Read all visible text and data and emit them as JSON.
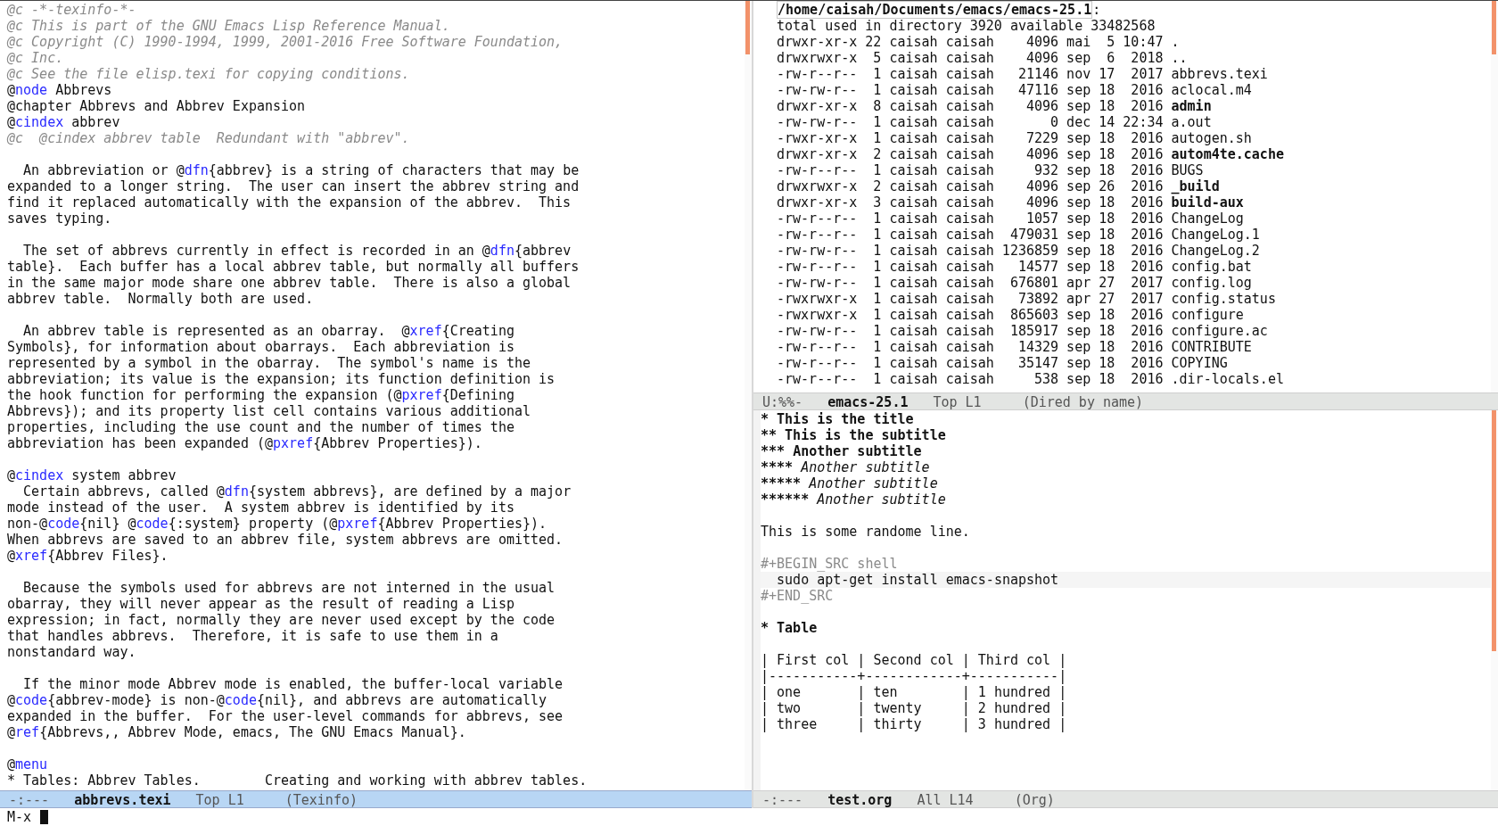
{
  "left_window": {
    "lines": [
      {
        "kind": "comment",
        "text": "@c -*-texinfo-*-"
      },
      {
        "kind": "comment",
        "text": "@c This is part of the GNU Emacs Lisp Reference Manual."
      },
      {
        "kind": "comment",
        "text": "@c Copyright (C) 1990-1994, 1999, 2001-2016 Free Software Foundation,"
      },
      {
        "kind": "comment",
        "text": "@c Inc."
      },
      {
        "kind": "comment",
        "text": "@c See the file elisp.texi for copying conditions."
      },
      {
        "kind": "text",
        "parts": [
          {
            "text": "@",
            "kind": "plain"
          },
          {
            "text": "node",
            "kind": "keyword"
          },
          {
            "text": " Abbrevs",
            "kind": "plain"
          }
        ]
      },
      {
        "kind": "text",
        "parts": [
          {
            "text": "@chapter Abbrevs and Abbrev Expansion",
            "kind": "plain"
          }
        ]
      },
      {
        "kind": "text",
        "parts": [
          {
            "text": "@",
            "kind": "plain"
          },
          {
            "text": "cindex",
            "kind": "keyword"
          },
          {
            "text": " abbrev",
            "kind": "plain"
          }
        ]
      },
      {
        "kind": "comment",
        "text": "@c  @cindex abbrev table  Redundant with \"abbrev\"."
      },
      {
        "kind": "blank"
      },
      {
        "kind": "text",
        "parts": [
          {
            "text": "  An abbreviation or @",
            "kind": "plain"
          },
          {
            "text": "dfn",
            "kind": "keyword"
          },
          {
            "text": "{abbrev} is a string of characters that may be",
            "kind": "plain"
          }
        ]
      },
      {
        "kind": "text",
        "parts": [
          {
            "text": "expanded to a longer string.  The user can insert the abbrev string and",
            "kind": "plain"
          }
        ]
      },
      {
        "kind": "text",
        "parts": [
          {
            "text": "find it replaced automatically with the expansion of the abbrev.  This",
            "kind": "plain"
          }
        ]
      },
      {
        "kind": "text",
        "parts": [
          {
            "text": "saves typing.",
            "kind": "plain"
          }
        ]
      },
      {
        "kind": "blank"
      },
      {
        "kind": "text",
        "parts": [
          {
            "text": "  The set of abbrevs currently in effect is recorded in an @",
            "kind": "plain"
          },
          {
            "text": "dfn",
            "kind": "keyword"
          },
          {
            "text": "{abbrev",
            "kind": "plain"
          }
        ]
      },
      {
        "kind": "text",
        "parts": [
          {
            "text": "table}.  Each buffer has a local abbrev table, but normally all buffers",
            "kind": "plain"
          }
        ]
      },
      {
        "kind": "text",
        "parts": [
          {
            "text": "in the same major mode share one abbrev table.  There is also a global",
            "kind": "plain"
          }
        ]
      },
      {
        "kind": "text",
        "parts": [
          {
            "text": "abbrev table.  Normally both are used.",
            "kind": "plain"
          }
        ]
      },
      {
        "kind": "blank"
      },
      {
        "kind": "text",
        "parts": [
          {
            "text": "  An abbrev table is represented as an obarray.  @",
            "kind": "plain"
          },
          {
            "text": "xref",
            "kind": "keyword"
          },
          {
            "text": "{Creating",
            "kind": "plain"
          }
        ]
      },
      {
        "kind": "text",
        "parts": [
          {
            "text": "Symbols}, for information about obarrays.  Each abbreviation is",
            "kind": "plain"
          }
        ]
      },
      {
        "kind": "text",
        "parts": [
          {
            "text": "represented by a symbol in the obarray.  The symbol's name is the",
            "kind": "plain"
          }
        ]
      },
      {
        "kind": "text",
        "parts": [
          {
            "text": "abbreviation; its value is the expansion; its function definition is",
            "kind": "plain"
          }
        ]
      },
      {
        "kind": "text",
        "parts": [
          {
            "text": "the hook function for performing the expansion (@",
            "kind": "plain"
          },
          {
            "text": "pxref",
            "kind": "keyword"
          },
          {
            "text": "{Defining",
            "kind": "plain"
          }
        ]
      },
      {
        "kind": "text",
        "parts": [
          {
            "text": "Abbrevs}); and its property list cell contains various additional",
            "kind": "plain"
          }
        ]
      },
      {
        "kind": "text",
        "parts": [
          {
            "text": "properties, including the use count and the number of times the",
            "kind": "plain"
          }
        ]
      },
      {
        "kind": "text",
        "parts": [
          {
            "text": "abbreviation has been expanded (@",
            "kind": "plain"
          },
          {
            "text": "pxref",
            "kind": "keyword"
          },
          {
            "text": "{Abbrev Properties}).",
            "kind": "plain"
          }
        ]
      },
      {
        "kind": "blank"
      },
      {
        "kind": "text",
        "parts": [
          {
            "text": "@",
            "kind": "plain"
          },
          {
            "text": "cindex",
            "kind": "keyword"
          },
          {
            "text": " system abbrev",
            "kind": "plain"
          }
        ]
      },
      {
        "kind": "text",
        "parts": [
          {
            "text": "  Certain abbrevs, called @",
            "kind": "plain"
          },
          {
            "text": "dfn",
            "kind": "keyword"
          },
          {
            "text": "{system abbrevs}, are defined by a major",
            "kind": "plain"
          }
        ]
      },
      {
        "kind": "text",
        "parts": [
          {
            "text": "mode instead of the user.  A system abbrev is identified by its",
            "kind": "plain"
          }
        ]
      },
      {
        "kind": "text",
        "parts": [
          {
            "text": "non-@",
            "kind": "plain"
          },
          {
            "text": "code",
            "kind": "keyword"
          },
          {
            "text": "{nil} @",
            "kind": "plain"
          },
          {
            "text": "code",
            "kind": "keyword"
          },
          {
            "text": "{:system} property (@",
            "kind": "plain"
          },
          {
            "text": "pxref",
            "kind": "keyword"
          },
          {
            "text": "{Abbrev Properties}).",
            "kind": "plain"
          }
        ]
      },
      {
        "kind": "text",
        "parts": [
          {
            "text": "When abbrevs are saved to an abbrev file, system abbrevs are omitted.",
            "kind": "plain"
          }
        ]
      },
      {
        "kind": "text",
        "parts": [
          {
            "text": "@",
            "kind": "plain"
          },
          {
            "text": "xref",
            "kind": "keyword"
          },
          {
            "text": "{Abbrev Files}.",
            "kind": "plain"
          }
        ]
      },
      {
        "kind": "blank"
      },
      {
        "kind": "text",
        "parts": [
          {
            "text": "  Because the symbols used for abbrevs are not interned in the usual",
            "kind": "plain"
          }
        ]
      },
      {
        "kind": "text",
        "parts": [
          {
            "text": "obarray, they will never appear as the result of reading a Lisp",
            "kind": "plain"
          }
        ]
      },
      {
        "kind": "text",
        "parts": [
          {
            "text": "expression; in fact, normally they are never used except by the code",
            "kind": "plain"
          }
        ]
      },
      {
        "kind": "text",
        "parts": [
          {
            "text": "that handles abbrevs.  Therefore, it is safe to use them in a",
            "kind": "plain"
          }
        ]
      },
      {
        "kind": "text",
        "parts": [
          {
            "text": "nonstandard way.",
            "kind": "plain"
          }
        ]
      },
      {
        "kind": "blank"
      },
      {
        "kind": "text",
        "parts": [
          {
            "text": "  If the minor mode Abbrev mode is enabled, the buffer-local variable",
            "kind": "plain"
          }
        ]
      },
      {
        "kind": "text",
        "parts": [
          {
            "text": "@",
            "kind": "plain"
          },
          {
            "text": "code",
            "kind": "keyword"
          },
          {
            "text": "{abbrev-mode} is non-@",
            "kind": "plain"
          },
          {
            "text": "code",
            "kind": "keyword"
          },
          {
            "text": "{nil}, and abbrevs are automatically",
            "kind": "plain"
          }
        ]
      },
      {
        "kind": "text",
        "parts": [
          {
            "text": "expanded in the buffer.  For the user-level commands for abbrevs, see",
            "kind": "plain"
          }
        ]
      },
      {
        "kind": "text",
        "parts": [
          {
            "text": "@",
            "kind": "plain"
          },
          {
            "text": "ref",
            "kind": "keyword"
          },
          {
            "text": "{Abbrevs,, Abbrev Mode, emacs, The GNU Emacs Manual}.",
            "kind": "plain"
          }
        ]
      },
      {
        "kind": "blank"
      },
      {
        "kind": "text",
        "parts": [
          {
            "text": "@",
            "kind": "plain"
          },
          {
            "text": "menu",
            "kind": "keyword"
          }
        ]
      },
      {
        "kind": "text",
        "parts": [
          {
            "text": "* Tables: Abbrev Tables.        Creating and working with abbrev tables.",
            "kind": "plain"
          }
        ]
      }
    ],
    "mode_line": {
      "status": "-:---",
      "buffer": "abbrevs.texi",
      "position": "Top L1",
      "mode": "(Texinfo)",
      "selected": true
    }
  },
  "dired_window": {
    "path": "/home/caisah/Documents/emacs/emacs-25.1",
    "path_suffix": ":",
    "summary": "total used in directory 3920 available 33482568",
    "entries": [
      {
        "info": "drwxr-xr-x 22 caisah caisah    4096 mai  5 10:47 ",
        "name": ".",
        "kind": "file"
      },
      {
        "info": "drwxrwxr-x  5 caisah caisah    4096 sep  6  2018 ",
        "name": "..",
        "kind": "file"
      },
      {
        "info": "-rw-r--r--  1 caisah caisah   21146 nov 17  2017 ",
        "name": "abbrevs.texi",
        "kind": "file"
      },
      {
        "info": "-rw-rw-r--  1 caisah caisah   47116 sep 18  2016 ",
        "name": "aclocal.m4",
        "kind": "file"
      },
      {
        "info": "drwxr-xr-x  8 caisah caisah    4096 sep 18  2016 ",
        "name": "admin",
        "kind": "dir"
      },
      {
        "info": "-rw-rw-r--  1 caisah caisah       0 dec 14 22:34 ",
        "name": "a.out",
        "kind": "file"
      },
      {
        "info": "-rwxr-xr-x  1 caisah caisah    7229 sep 18  2016 ",
        "name": "autogen.sh",
        "kind": "file"
      },
      {
        "info": "drwxr-xr-x  2 caisah caisah    4096 sep 18  2016 ",
        "name": "autom4te.cache",
        "kind": "dir"
      },
      {
        "info": "-rw-r--r--  1 caisah caisah     932 sep 18  2016 ",
        "name": "BUGS",
        "kind": "file"
      },
      {
        "info": "drwxrwxr-x  2 caisah caisah    4096 sep 26  2016 ",
        "name": "_build",
        "kind": "dir"
      },
      {
        "info": "drwxr-xr-x  3 caisah caisah    4096 sep 18  2016 ",
        "name": "build-aux",
        "kind": "dir"
      },
      {
        "info": "-rw-r--r--  1 caisah caisah    1057 sep 18  2016 ",
        "name": "ChangeLog",
        "kind": "file"
      },
      {
        "info": "-rw-r--r--  1 caisah caisah  479031 sep 18  2016 ",
        "name": "ChangeLog.1",
        "kind": "file"
      },
      {
        "info": "-rw-rw-r--  1 caisah caisah 1236859 sep 18  2016 ",
        "name": "ChangeLog.2",
        "kind": "file"
      },
      {
        "info": "-rw-r--r--  1 caisah caisah   14577 sep 18  2016 ",
        "name": "config.bat",
        "kind": "file"
      },
      {
        "info": "-rw-rw-r--  1 caisah caisah  676801 apr 27  2017 ",
        "name": "config.log",
        "kind": "file"
      },
      {
        "info": "-rwxrwxr-x  1 caisah caisah   73892 apr 27  2017 ",
        "name": "config.status",
        "kind": "file"
      },
      {
        "info": "-rwxrwxr-x  1 caisah caisah  865603 sep 18  2016 ",
        "name": "configure",
        "kind": "file"
      },
      {
        "info": "-rw-rw-r--  1 caisah caisah  185917 sep 18  2016 ",
        "name": "configure.ac",
        "kind": "file"
      },
      {
        "info": "-rw-r--r--  1 caisah caisah   14329 sep 18  2016 ",
        "name": "CONTRIBUTE",
        "kind": "file"
      },
      {
        "info": "-rw-r--r--  1 caisah caisah   35147 sep 18  2016 ",
        "name": "COPYING",
        "kind": "file"
      },
      {
        "info": "-rw-r--r--  1 caisah caisah     538 sep 18  2016 ",
        "name": ".dir-locals.el",
        "kind": "file"
      }
    ],
    "mode_line": {
      "status": "U:%%-",
      "buffer": "emacs-25.1",
      "position": "Top L1",
      "mode": "(Dired by name)",
      "selected": false
    }
  },
  "org_window": {
    "lines": [
      {
        "kind": "heading",
        "stars": "*",
        "title": "This is the title"
      },
      {
        "kind": "heading",
        "stars": "**",
        "title": "This is the subtitle"
      },
      {
        "kind": "heading",
        "stars": "***",
        "title": "Another subtitle"
      },
      {
        "kind": "heading",
        "stars": "****",
        "title": "Another subtitle"
      },
      {
        "kind": "heading",
        "stars": "*****",
        "title": "Another subtitle"
      },
      {
        "kind": "heading",
        "stars": "******",
        "title": "Another subtitle"
      },
      {
        "kind": "blank"
      },
      {
        "kind": "text",
        "text": "This is some randome line."
      },
      {
        "kind": "blank"
      },
      {
        "kind": "meta",
        "text": "#+BEGIN_SRC shell"
      },
      {
        "kind": "src",
        "text": "  sudo apt-get install emacs-snapshot"
      },
      {
        "kind": "meta",
        "text": "#+END_SRC"
      },
      {
        "kind": "blank"
      },
      {
        "kind": "heading",
        "stars": "*",
        "title": "Table"
      },
      {
        "kind": "blank"
      },
      {
        "kind": "table",
        "text": "| First col | Second col | Third col |"
      },
      {
        "kind": "table",
        "text": "|-----------+------------+-----------|"
      },
      {
        "kind": "table",
        "text": "| one       | ten        | 1 hundred |"
      },
      {
        "kind": "table",
        "text": "| two       | twenty     | 2 hundred |"
      },
      {
        "kind": "table",
        "text": "| three     | thirty     | 3 hundred |"
      }
    ],
    "mode_line": {
      "status": "-:---",
      "buffer": "test.org",
      "position": "All L14",
      "mode": "(Org)",
      "selected": false
    }
  },
  "minibuffer": {
    "prompt": "M-x"
  }
}
